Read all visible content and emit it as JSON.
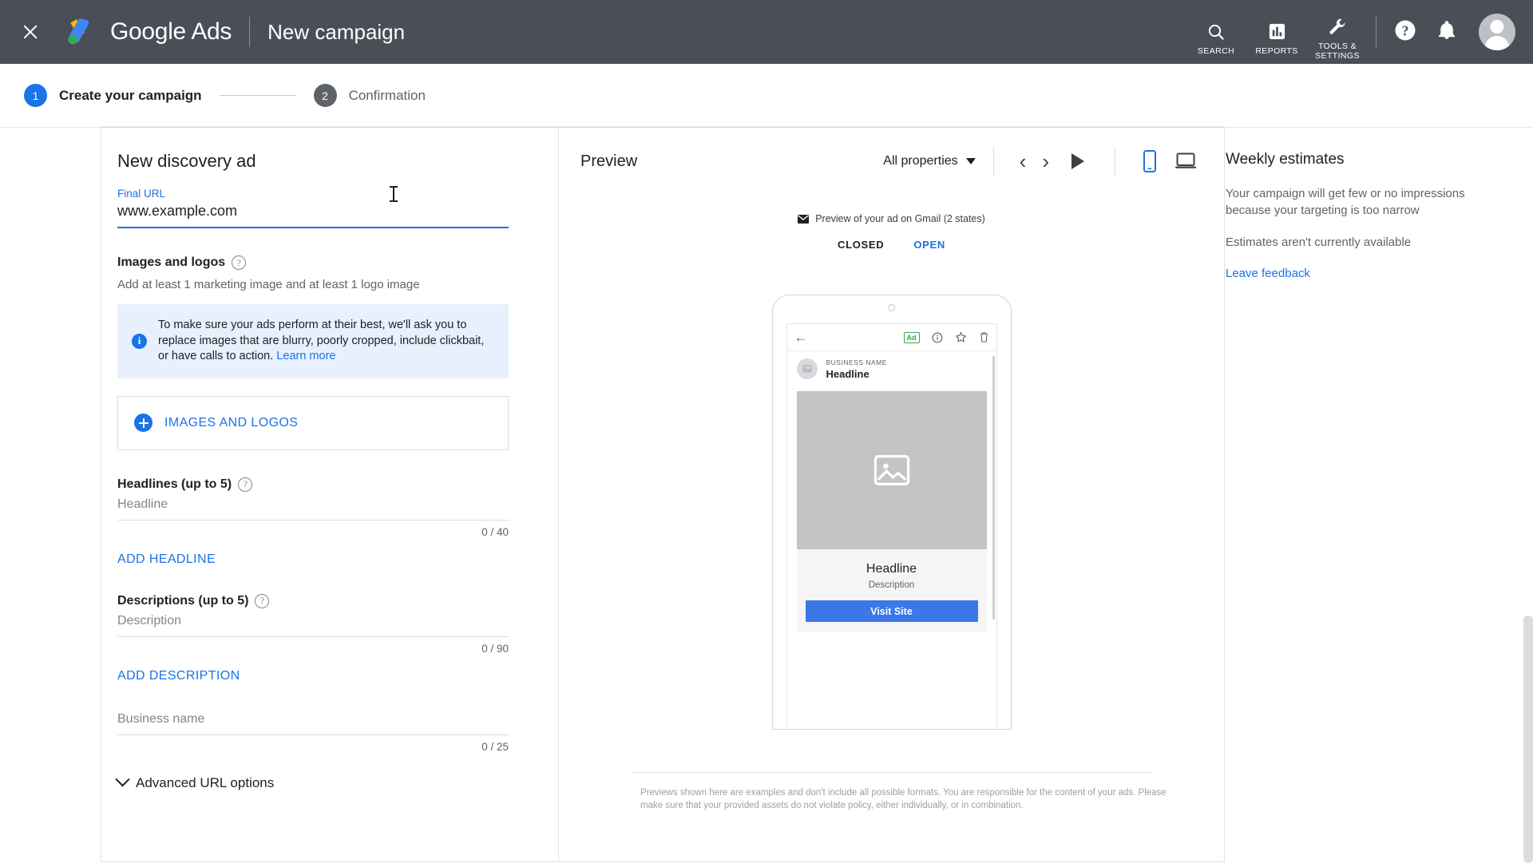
{
  "topbar": {
    "close_icon": "close-icon",
    "logo_icon": "google-ads-logo-icon",
    "brand": "Google Ads",
    "page_title": "New campaign",
    "items": [
      {
        "icon": "search-icon",
        "label": "SEARCH"
      },
      {
        "icon": "reports-icon",
        "label": "REPORTS"
      },
      {
        "icon": "wrench-icon",
        "label": "TOOLS &\nSETTINGS"
      }
    ],
    "tools_label_line1": "TOOLS &",
    "tools_label_line2": "SETTINGS",
    "help_icon": "help-icon",
    "notifications_icon": "bell-icon",
    "avatar": "avatar"
  },
  "stepper": {
    "steps": [
      {
        "number": "1",
        "label": "Create your campaign",
        "active": true
      },
      {
        "number": "2",
        "label": "Confirmation",
        "active": false
      }
    ]
  },
  "form": {
    "title": "New discovery ad",
    "final_url": {
      "label": "Final URL",
      "value": "www.example.com",
      "help_icon": "help-icon"
    },
    "images_section": {
      "title": "Images and logos",
      "help_icon": "help-icon",
      "subtitle": "Add at least 1 marketing image and at least 1 logo image",
      "banner": {
        "icon": "info-icon",
        "text": "To make sure your ads perform at their best, we'll ask you to replace images that are blurry, poorly cropped, include clickbait, or have calls to action. ",
        "link": "Learn more"
      },
      "add_button": {
        "icon": "plus-circle-icon",
        "label": "IMAGES AND LOGOS"
      }
    },
    "headlines": {
      "label": "Headlines (up to 5)",
      "help_icon": "help-icon",
      "placeholder": "Headline",
      "counter": "0 / 40",
      "add_label": "ADD HEADLINE"
    },
    "descriptions": {
      "label": "Descriptions (up to 5)",
      "help_icon": "help-icon",
      "placeholder": "Description",
      "counter": "0 / 90",
      "add_label": "ADD DESCRIPTION"
    },
    "business_name": {
      "placeholder": "Business name",
      "counter": "0 / 25",
      "help_icon": "help-icon"
    },
    "advanced_url": {
      "label": "Advanced URL options",
      "chevron_icon": "chevron-down-icon"
    }
  },
  "preview": {
    "title": "Preview",
    "properties_select": "All properties",
    "caret_icon": "chevron-down-icon",
    "prev_icon": "chevron-left-icon",
    "next_icon": "chevron-right-icon",
    "play_icon": "play-icon",
    "mobile_icon": "mobile-device-icon",
    "desktop_icon": "desktop-device-icon",
    "gmail_note": "Preview of your ad on Gmail (2 states)",
    "mail_icon": "envelope-icon",
    "states": [
      {
        "label": "CLOSED",
        "selected": true
      },
      {
        "label": "OPEN",
        "selected": false
      }
    ],
    "phone": {
      "back_icon": "back-arrow-icon",
      "ad_badge": "Ad",
      "info_icon": "info-circle-icon",
      "star_icon": "star-icon",
      "delete_icon": "trash-icon",
      "avatar_icon": "image-placeholder-icon",
      "business_name": "BUSINESS NAME",
      "headline_top": "Headline",
      "hero_icon": "image-placeholder-icon",
      "headline": "Headline",
      "description": "Description",
      "cta": "Visit Site"
    },
    "footer": "Previews shown here are examples and don't include all possible formats. You are responsible for the content of your ads. Please make sure that your provided assets do not violate policy, either individually, or in combination."
  },
  "estimates": {
    "title": "Weekly estimates",
    "message": "Your campaign will get few or no impressions because your targeting is too narrow",
    "unavailable": "Estimates aren't currently available",
    "feedback_link": "Leave feedback"
  },
  "colors": {
    "brand_blue": "#1a73e8",
    "topbar_bg": "#4a4e57",
    "banner_bg": "#e8f0fe",
    "cta_blue": "#3b78e7",
    "ad_green": "#34a853"
  }
}
